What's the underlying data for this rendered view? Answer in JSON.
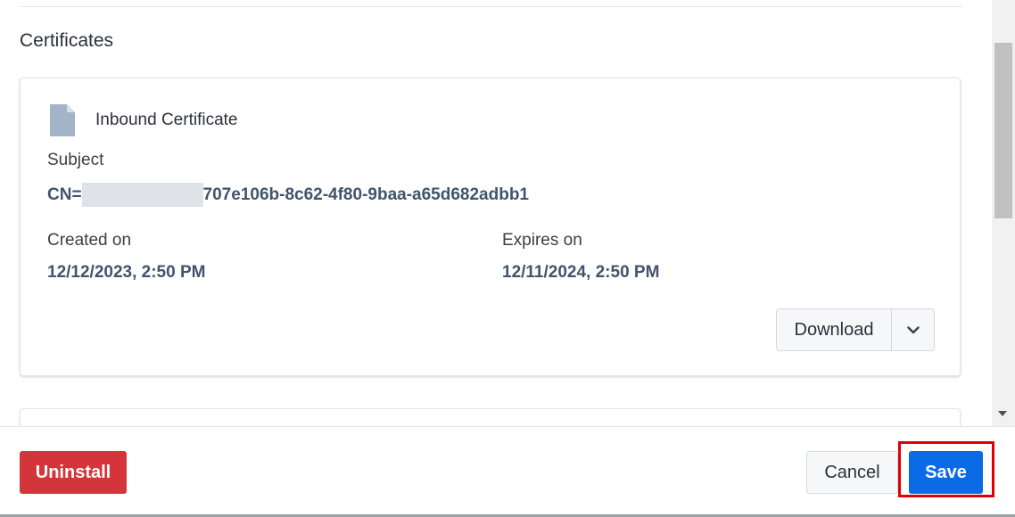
{
  "section": {
    "title": "Certificates"
  },
  "certificate": {
    "icon": "document-icon",
    "title": "Inbound Certificate",
    "subject_label": "Subject",
    "subject_prefix": "CN=",
    "subject_value": "707e106b-8c62-4f80-9baa-a65d682adbb1",
    "created_label": "Created on",
    "created_value": "12/12/2023, 2:50 PM",
    "expires_label": "Expires on",
    "expires_value": "12/11/2024, 2:50 PM",
    "download_label": "Download"
  },
  "footer": {
    "uninstall_label": "Uninstall",
    "cancel_label": "Cancel",
    "save_label": "Save"
  },
  "colors": {
    "primary": "#0b6be6",
    "danger": "#d4353b",
    "value_text": "#40546d",
    "highlight": "#e00000"
  }
}
